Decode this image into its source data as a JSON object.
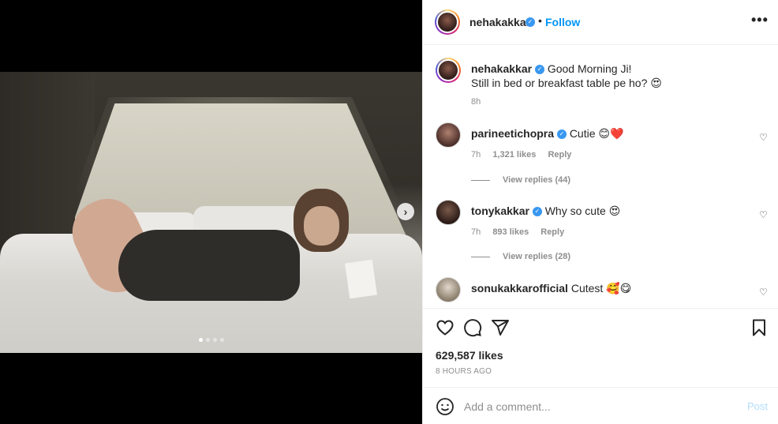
{
  "post": {
    "author": "nehakakkar",
    "follow_label": "Follow",
    "separator": "•",
    "more_label": "•••",
    "caption_line1": "Good Morning Ji!",
    "caption_line2": "Still in bed or breakfast table pe ho? 😍",
    "caption_time": "8h",
    "carousel_next": "›",
    "carousel_slide_count": 4,
    "carousel_active_index": 0,
    "likes": "629,587 likes",
    "time_ago": "8 HOURS AGO"
  },
  "comments": [
    {
      "user": "parineetichopra",
      "text": "Cutie 😊❤️",
      "time": "7h",
      "likes": "1,321 likes",
      "reply": "Reply",
      "view_replies": "View replies (44)"
    },
    {
      "user": "tonykakkar",
      "text": "Why so cute 😍",
      "time": "7h",
      "likes": "893 likes",
      "reply": "Reply",
      "view_replies": "View replies (28)"
    },
    {
      "user": "sonukakkarofficial",
      "text": "Cutest 🥰😋"
    }
  ],
  "comment_box": {
    "placeholder": "Add a comment...",
    "post_label": "Post"
  },
  "colors": {
    "follow": "#0095f6",
    "verified": "#3897f0",
    "post_disabled": "#b2dffc",
    "muted": "#8e8e8e"
  },
  "icons": [
    "verified-badge-icon",
    "heart-icon",
    "comment-icon",
    "share-icon",
    "bookmark-icon",
    "emoji-icon",
    "chevron-right-icon"
  ]
}
